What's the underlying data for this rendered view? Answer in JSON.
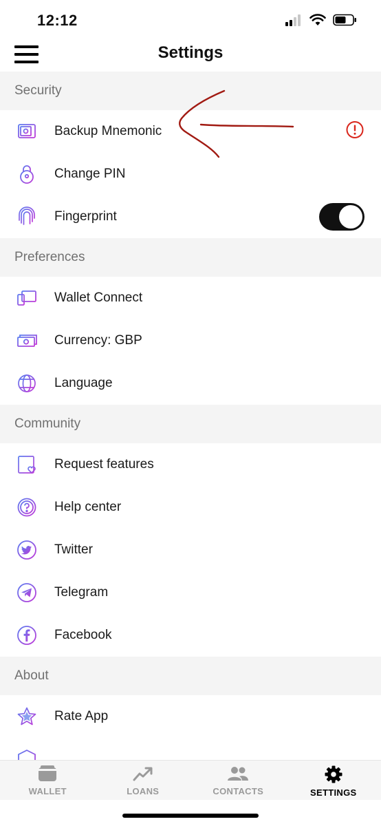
{
  "status_bar": {
    "time": "12:12"
  },
  "header": {
    "title": "Settings"
  },
  "sections": {
    "security": {
      "title": "Security",
      "items": [
        {
          "label": "Backup Mnemonic",
          "icon": "safe-icon"
        },
        {
          "label": "Change PIN",
          "icon": "lock-icon"
        },
        {
          "label": "Fingerprint",
          "icon": "fingerprint-icon",
          "toggle_on": true
        }
      ]
    },
    "preferences": {
      "title": "Preferences",
      "items": [
        {
          "label": "Wallet Connect",
          "icon": "devices-icon"
        },
        {
          "label": "Currency: GBP",
          "icon": "banknotes-icon"
        },
        {
          "label": "Language",
          "icon": "globe-icon"
        }
      ]
    },
    "community": {
      "title": "Community",
      "items": [
        {
          "label": "Request features",
          "icon": "feature-request-icon"
        },
        {
          "label": "Help center",
          "icon": "help-icon"
        },
        {
          "label": "Twitter",
          "icon": "twitter-icon"
        },
        {
          "label": "Telegram",
          "icon": "telegram-icon"
        },
        {
          "label": "Facebook",
          "icon": "facebook-icon"
        }
      ]
    },
    "about": {
      "title": "About",
      "items": [
        {
          "label": "Rate App",
          "icon": "star-icon"
        }
      ]
    }
  },
  "tabs": [
    {
      "label": "WALLET",
      "icon": "wallet-icon",
      "active": false
    },
    {
      "label": "LOANS",
      "icon": "trend-up-icon",
      "active": false
    },
    {
      "label": "CONTACTS",
      "icon": "people-icon",
      "active": false
    },
    {
      "label": "SETTINGS",
      "icon": "gear-icon",
      "active": true
    }
  ],
  "colors": {
    "icon_gradient_start": "#5b7cf0",
    "icon_gradient_end": "#c03ad8",
    "warning": "#d9261c",
    "annotation_stroke": "#a11a12",
    "section_bg": "#f4f4f4"
  }
}
